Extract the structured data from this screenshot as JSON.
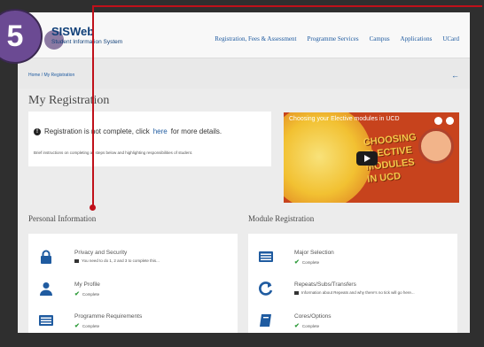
{
  "step_badge": "5",
  "app": {
    "title": "SISWeb",
    "subtitle": "Student Information System"
  },
  "nav": [
    "Registration, Fees & Assessment",
    "Programme Services",
    "Campus",
    "Applications",
    "UCard"
  ],
  "breadcrumb": "Home  /  My Registration",
  "page_title": "My Registration",
  "notice": {
    "before": "Registration is not complete, click ",
    "link": "here",
    "after": " for more details.",
    "sub": "Brief instructions on completing all steps below and highlighting responsibilities of student."
  },
  "video": {
    "title": "Choosing your Elective modules in UCD",
    "words": [
      "CHOOSING",
      "ELECTIVE",
      "MODULES",
      "IN UCD"
    ]
  },
  "personal": {
    "title": "Personal Information",
    "items": [
      {
        "icon": "lock-icon",
        "name": "Privacy and Security",
        "status": "You need to do 1, 2 and 3 to complete this...",
        "status_type": "flag"
      },
      {
        "icon": "user-icon",
        "name": "My Profile",
        "status": "Complete",
        "status_type": "check"
      },
      {
        "icon": "list-icon",
        "name": "Programme Requirements",
        "status": "Complete",
        "status_type": "check"
      }
    ]
  },
  "modules": {
    "title": "Module Registration",
    "items": [
      {
        "icon": "list-icon",
        "name": "Major Selection",
        "status": "Complete",
        "status_type": "check"
      },
      {
        "icon": "refresh-icon",
        "name": "Repeats/Subs/Transfers",
        "status": "Information about Repeats and why there's no tick will go here...",
        "status_type": "flag"
      },
      {
        "icon": "book-icon",
        "name": "Cores/Options",
        "status": "Complete",
        "status_type": "check"
      }
    ]
  },
  "colors": {
    "accent": "#1f5ba0",
    "badge": "#6b4a93",
    "marker": "#c0101a",
    "complete": "#2e9b3a"
  }
}
